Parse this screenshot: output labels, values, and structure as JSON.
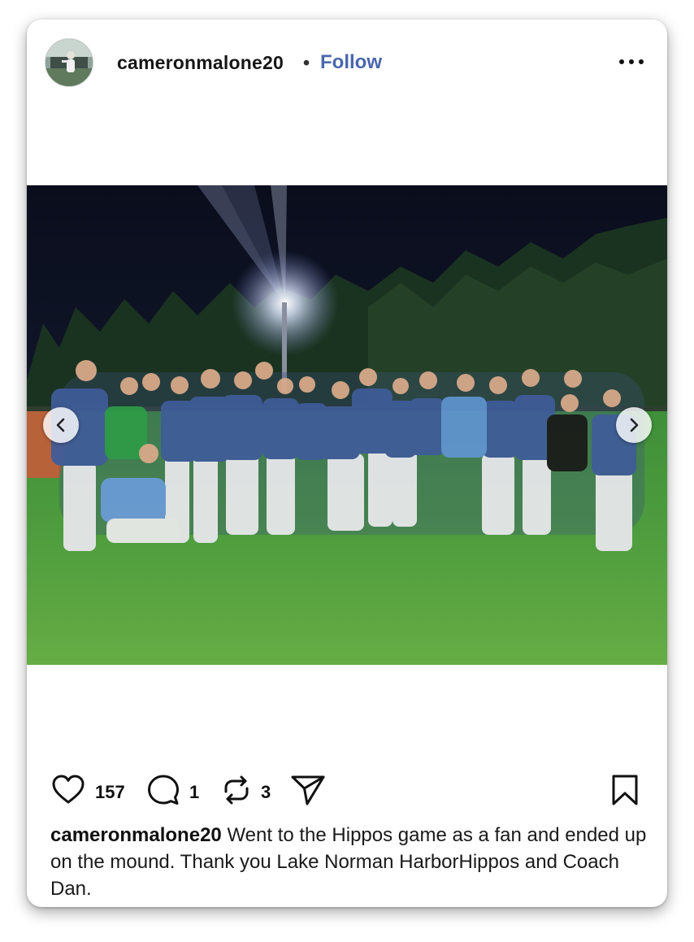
{
  "post": {
    "username": "cameronmalone20",
    "separator": "•",
    "follow_label": "Follow",
    "likes": "157",
    "comments": "1",
    "reposts": "3",
    "caption_user": "cameronmalone20",
    "caption_text": "Went to the Hippos game as a fan and ended up on the mound. Thank you Lake Norman HarborHippos and Coach Dan."
  },
  "icons": {
    "more": "more-options-icon",
    "like": "heart-icon",
    "comment": "comment-icon",
    "repost": "repost-icon",
    "share": "send-icon",
    "save": "bookmark-icon",
    "prev": "chevron-left-icon",
    "next": "chevron-right-icon"
  },
  "colors": {
    "follow": "#4a66ad",
    "text": "#111111"
  }
}
